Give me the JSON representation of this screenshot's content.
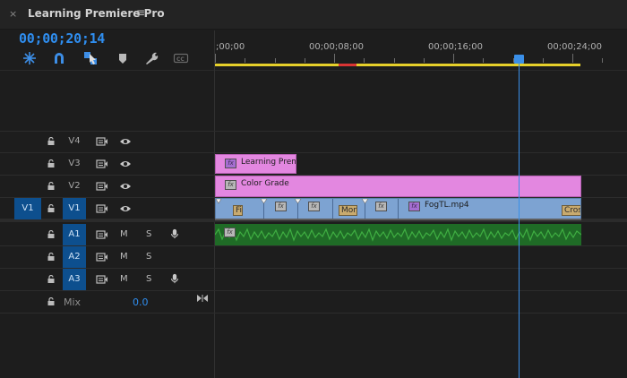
{
  "panel": {
    "title": "Learning Premiere Pro",
    "close_symbol": "×",
    "menu_symbol": "≡",
    "timecode": "00;00;20;14",
    "tools": [
      "snap-icon",
      "magnet-icon",
      "linked-selection-icon",
      "add-marker-icon",
      "wrench-icon",
      "captions-icon"
    ]
  },
  "ruler": {
    "labels": [
      ";00;00",
      "00;00;08;00",
      "00;00;16;00",
      "00;00;24;00"
    ]
  },
  "video_tracks": [
    {
      "name": "V4"
    },
    {
      "name": "V3"
    },
    {
      "name": "V2"
    },
    {
      "name": "V1",
      "source": "V1"
    }
  ],
  "audio_tracks": [
    {
      "name": "A1",
      "m": "M",
      "s": "S"
    },
    {
      "name": "A2",
      "m": "M",
      "s": "S"
    },
    {
      "name": "A3",
      "m": "M",
      "s": "S"
    }
  ],
  "mix": {
    "label": "Mix",
    "value": "0.0"
  },
  "clips": {
    "v3_title": "Learning Prem",
    "v2_adjust": "Color Grade",
    "v1_main": "FogTL.mp4",
    "transitions": [
      "Fi",
      "Mor",
      "Cros"
    ]
  },
  "colors": {
    "accent": "#2f8ef0",
    "work_area": "#e6d02a",
    "playhead": "#3a8fe8"
  }
}
